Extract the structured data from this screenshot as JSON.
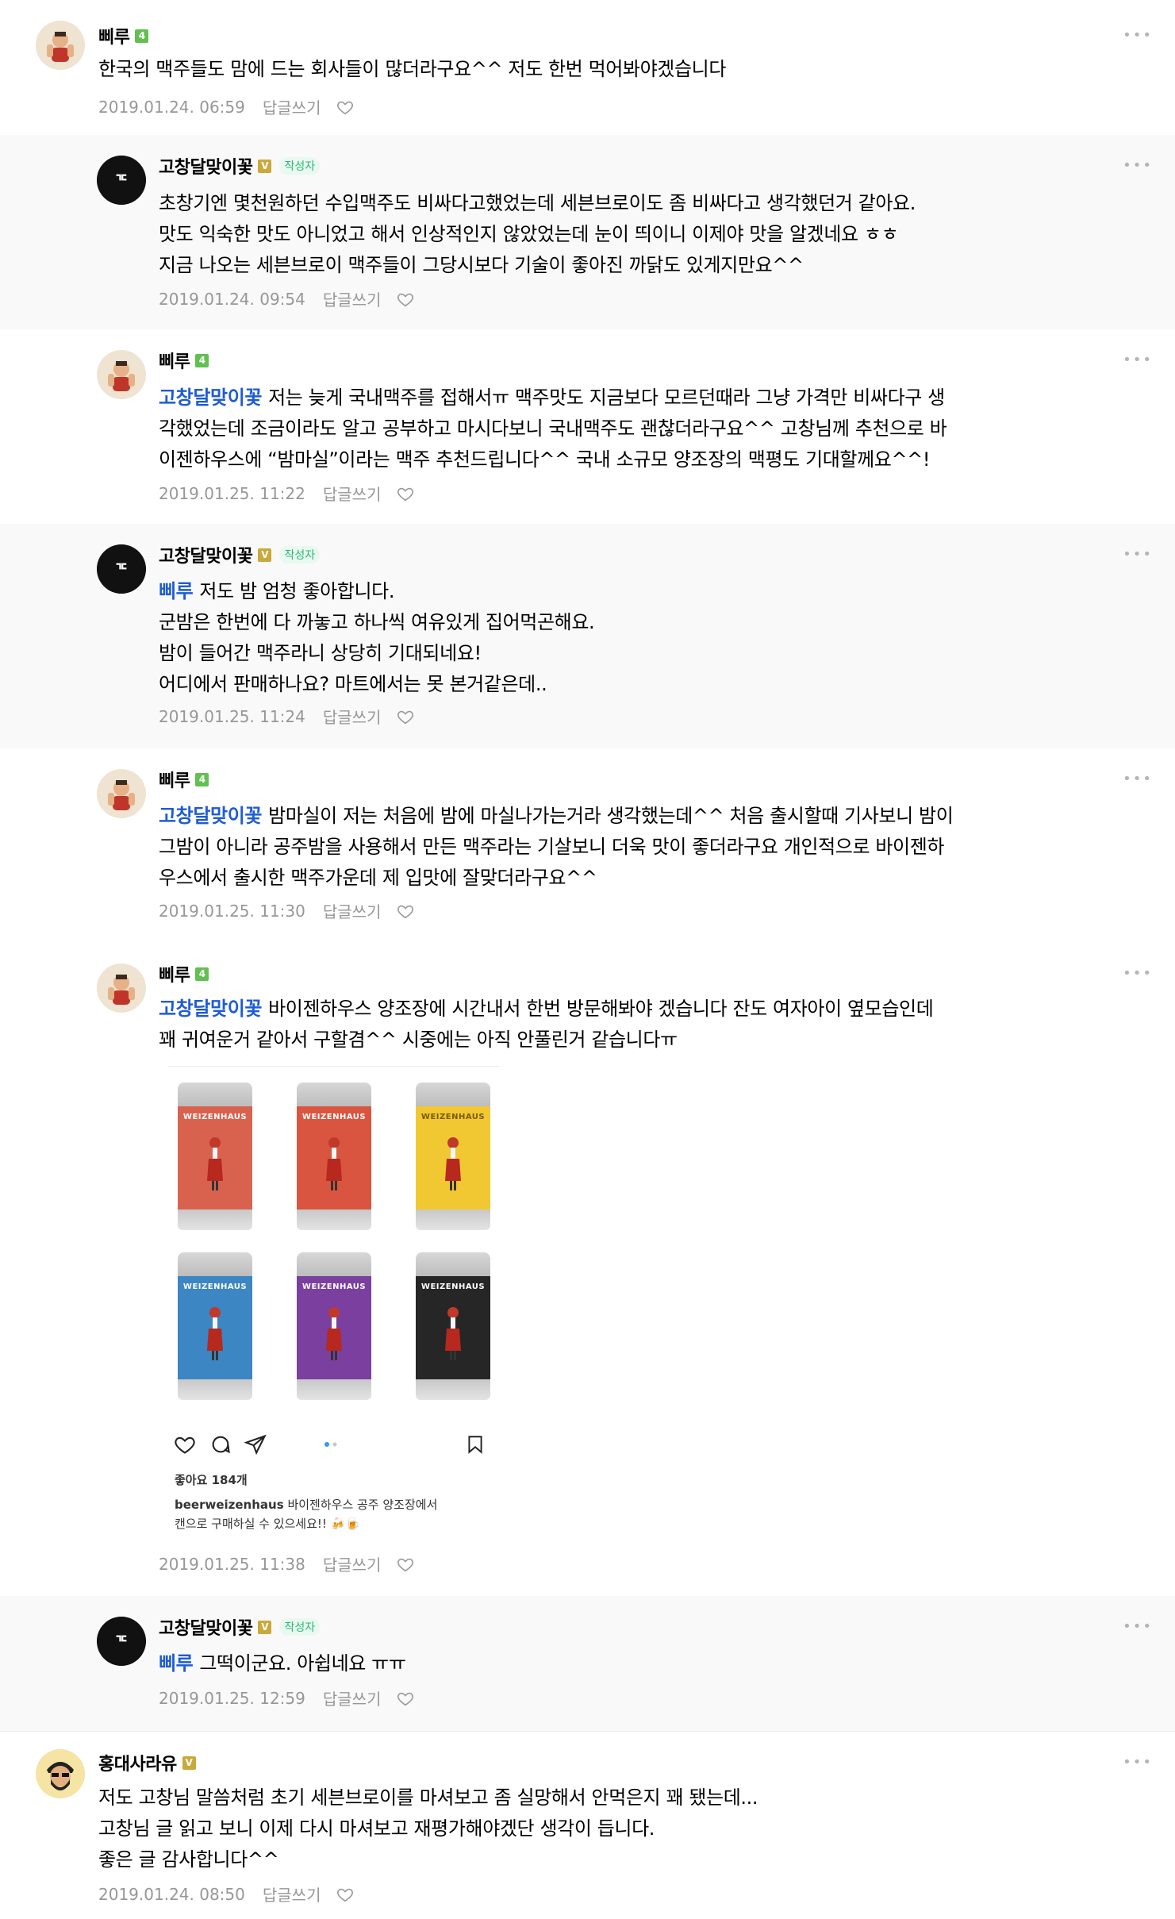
{
  "comments": [
    {
      "nick": "삐루",
      "level": "4",
      "mention": "",
      "lines": [
        "한국의 맥주들도 맘에 드는 회사들이 많더라구요^^ 저도 한번 먹어봐야겠습니다"
      ],
      "date": "2019.01.24. 06:59",
      "reply_label": "답글쓰기"
    },
    {
      "nick": "고창달맞이꽃",
      "level": "V",
      "badge": "작성자",
      "mention": "",
      "lines": [
        "초창기엔 몇천원하던 수입맥주도 비싸다고했었는데 세븐브로이도 좀 비싸다고 생각했던거 같아요.",
        "맛도 익숙한 맛도 아니었고 해서 인상적인지 않았었는데 눈이 띄이니 이제야 맛을 알겠네요 ㅎㅎ",
        "지금 나오는 세븐브로이 맥주들이 그당시보다 기술이 좋아진 까닭도 있게지만요^^"
      ],
      "date": "2019.01.24. 09:54",
      "reply_label": "답글쓰기"
    },
    {
      "nick": "삐루",
      "level": "4",
      "mention": "고창달맞이꽃",
      "lines": [
        "저는 늦게 국내맥주를 접해서ㅠ 맥주맛도 지금보다 모르던때라 그냥 가격만 비싸다구 생",
        "각했었는데 조금이라도 알고 공부하고 마시다보니 국내맥주도 괜찮더라구요^^ 고창님께 추천으로 바",
        "이젠하우스에 “밤마실”이라는 맥주 추천드립니다^^ 국내 소규모 양조장의 맥평도 기대할께요^^!"
      ],
      "date": "2019.01.25. 11:22",
      "reply_label": "답글쓰기"
    },
    {
      "nick": "고창달맞이꽃",
      "level": "V",
      "badge": "작성자",
      "mention": "삐루",
      "lines": [
        "저도 밤 엄청 좋아합니다.",
        "군밤은 한번에 다 까놓고 하나씩 여유있게 집어먹곤해요.",
        "밤이 들어간 맥주라니 상당히 기대되네요!",
        "어디에서 판매하나요? 마트에서는 못 본거같은데.."
      ],
      "date": "2019.01.25. 11:24",
      "reply_label": "답글쓰기"
    },
    {
      "nick": "삐루",
      "level": "4",
      "mention": "고창달맞이꽃",
      "lines": [
        "밤마실이 저는 처음에 밤에 마실나가는거라 생각했는데^^ 처음 출시할때 기사보니 밤이",
        "그밤이 아니라 공주밤을 사용해서 만든 맥주라는 기살보니 더욱 맛이 좋더라구요 개인적으로 바이젠하",
        "우스에서 출시한 맥주가운데 제 입맛에 잘맞더라구요^^"
      ],
      "date": "2019.01.25. 11:30",
      "reply_label": "답글쓰기"
    },
    {
      "nick": "삐루",
      "level": "4",
      "mention": "고창달맞이꽃",
      "lines": [
        "바이젠하우스 양조장에 시간내서 한번 방문해봐야 겠습니다 잔도 여자아이 옆모습인데",
        "꽤 귀여운거 같아서 구할겸^^ 시중에는 아직 안풀린거 같습니다ㅠ"
      ],
      "date": "2019.01.25. 11:38",
      "reply_label": "답글쓰기"
    },
    {
      "nick": "고창달맞이꽃",
      "level": "V",
      "badge": "작성자",
      "mention": "삐루",
      "lines": [
        "그떡이군요. 아쉽네요 ㅠㅠ"
      ],
      "date": "2019.01.25. 12:59",
      "reply_label": "답글쓰기"
    },
    {
      "nick": "홍대사라유",
      "level": "V",
      "mention": "",
      "lines": [
        "저도 고창님 말씀처럼 초기 세븐브로이를 마셔보고 좀 실망해서 안먹은지 꽤 됐는데...",
        "고창님 글 읽고 보니 이제 다시 마셔보고 재평가해야겠단 생각이 듭니다.",
        "좋은 글 감사합니다^^"
      ],
      "date": "2019.01.24. 08:50",
      "reply_label": "답글쓰기"
    }
  ],
  "attachment": {
    "brand": "WEIZENHAUS",
    "cans": [
      {
        "color": "#d9624f"
      },
      {
        "color": "#d9553f"
      },
      {
        "color": "#f2c832"
      },
      {
        "color": "#3b86c3"
      },
      {
        "color": "#7b3fa0"
      },
      {
        "color": "#262626"
      }
    ],
    "likes": "좋아요 184개",
    "caption_user": "beerweizenhaus",
    "caption_line1": "바이젠하우스 공주 양조장에서",
    "caption_line2": "캔으로 구매하실 수 있으세요!! 🍻🍺"
  },
  "more_icon": "more-dots-icon",
  "heart_icon": "heart-outline-icon"
}
